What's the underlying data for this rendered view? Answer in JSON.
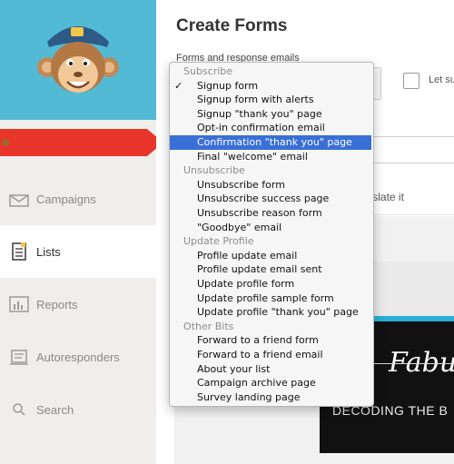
{
  "sidebar": {
    "nav": [
      {
        "label": "Campaigns",
        "icon": "envelope-icon"
      },
      {
        "label": "Lists",
        "icon": "list-icon"
      },
      {
        "label": "Reports",
        "icon": "bar-chart-icon"
      },
      {
        "label": "Autoresponders",
        "icon": "autoresponder-icon"
      },
      {
        "label": "Search",
        "icon": "search-icon"
      }
    ],
    "active": "Lists"
  },
  "main": {
    "title": "Create Forms",
    "field_label": "Forms and response emails",
    "checkbox_label": "Let su",
    "translate": "Translate it"
  },
  "preview": {
    "title": "Fabu",
    "subtitle": "DECODING THE B"
  },
  "menu": {
    "groups": [
      {
        "header": "Subscribe",
        "items": [
          "Signup form",
          "Signup form with alerts",
          "Signup \"thank you\" page",
          "Opt-in confirmation email",
          "Confirmation \"thank you\" page",
          "Final \"welcome\" email"
        ]
      },
      {
        "header": "Unsubscribe",
        "items": [
          "Unsubscribe form",
          "Unsubscribe success page",
          "Unsubscribe reason form",
          "\"Goodbye\" email"
        ]
      },
      {
        "header": "Update Profile",
        "items": [
          "Profile update email",
          "Profile update email sent",
          "Update profile form",
          "Update profile sample form",
          "Update profile \"thank you\" page"
        ]
      },
      {
        "header": "Other Bits",
        "items": [
          "Forward to a friend form",
          "Forward to a friend email",
          "About your list",
          "Campaign archive page",
          "Survey landing page"
        ]
      }
    ],
    "checked": "Signup form",
    "highlighted": "Confirmation \"thank you\" page"
  },
  "colors": {
    "accent": "#3a6fd8",
    "logo_bg": "#52bad5",
    "pointer": "#e8362b",
    "banner_border": "#2ab0d4"
  }
}
